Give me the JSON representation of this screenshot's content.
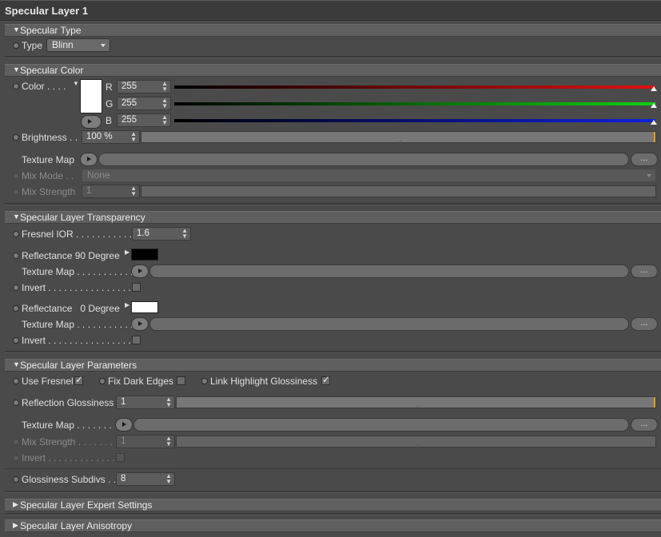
{
  "title": "Specular Layer 1",
  "sections": {
    "type": "Specular Type",
    "color": "Specular Color",
    "transparency": "Specular Layer Transparency",
    "params": "Specular Layer Parameters",
    "expert": "Specular Layer Expert Settings",
    "aniso": "Specular Layer Anisotropy"
  },
  "type_row": {
    "label": "Type",
    "value": "Blinn"
  },
  "color": {
    "label": "Color . . . .",
    "swatch": "#ffffff",
    "r_label": "R",
    "r": "255",
    "r_color": "#e01010",
    "g_label": "G",
    "g": "255",
    "g_color": "#10d010",
    "b_label": "B",
    "b": "255",
    "b_color": "#1020e0",
    "brightness_label": "Brightness . .",
    "brightness": "100 %",
    "texture_label": "Texture Map",
    "texture_dots": "...",
    "mix_mode_label": "Mix Mode . .",
    "mix_mode": "None",
    "mix_strength_label": "Mix Strength",
    "mix_strength": "1"
  },
  "transparency": {
    "fresnel_label": "Fresnel IOR . . . . . . . . . . . .",
    "fresnel": "1.6",
    "refl90_label": "Reflectance 90 Degree",
    "refl90_color": "#000000",
    "tex1_label": "Texture Map . . . . . . . . . . .",
    "tex1_dots": "...",
    "invert1_label": "Invert . . . . . . . . . . . . . . . . .",
    "refl0_label": "Reflectance   0 Degree",
    "refl0_color": "#ffffff",
    "tex2_label": "Texture Map . . . . . . . . . . .",
    "tex2_dots": "...",
    "invert2_label": "Invert . . . . . . . . . . . . . . . . ."
  },
  "params": {
    "use_fresnel": "Use Fresnel",
    "use_fresnel_checked": true,
    "fix_dark": "Fix Dark Edges",
    "fix_dark_checked": false,
    "link_gloss": "Link Highlight Glossiness",
    "link_gloss_checked": true,
    "refl_gloss_label": "Reflection Glossiness",
    "refl_gloss": "1",
    "tex_label": "Texture Map . . . . . . .",
    "tex_dots": "...",
    "mix_strength_label": "Mix Strength . . . . . . .",
    "mix_strength": "1",
    "invert_label": "Invert . . . . . . . . . . . . . .",
    "subdivs_label": "Glossiness Subdivs . .",
    "subdivs": "8"
  }
}
